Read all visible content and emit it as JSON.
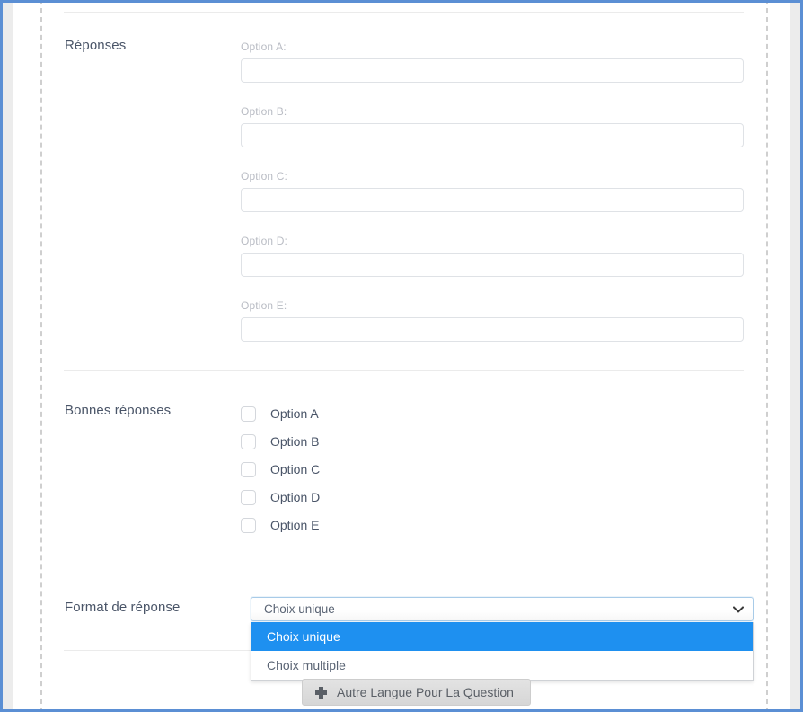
{
  "theme": {
    "accent_blue": "#5b8fd4",
    "dropdown_highlight": "#1e90f0",
    "label_color": "#4a5568",
    "caption_color": "#b9bcc4"
  },
  "form": {
    "answers": {
      "label": "Réponses",
      "options": [
        {
          "caption": "Option A:",
          "value": "",
          "placeholder": ""
        },
        {
          "caption": "Option B:",
          "value": "",
          "placeholder": ""
        },
        {
          "caption": "Option C:",
          "value": "",
          "placeholder": ""
        },
        {
          "caption": "Option D:",
          "value": "",
          "placeholder": ""
        },
        {
          "caption": "Option E:",
          "value": "",
          "placeholder": ""
        }
      ]
    },
    "correct_answers": {
      "label": "Bonnes réponses",
      "checkboxes": [
        {
          "label": "Option A",
          "checked": false
        },
        {
          "label": "Option B",
          "checked": false
        },
        {
          "label": "Option C",
          "checked": false
        },
        {
          "label": "Option D",
          "checked": false
        },
        {
          "label": "Option E",
          "checked": false
        }
      ]
    },
    "response_format": {
      "label": "Format de réponse",
      "selected": "Choix unique",
      "expanded": true,
      "options": [
        {
          "label": "Choix unique",
          "highlighted": true
        },
        {
          "label": "Choix multiple",
          "highlighted": false
        }
      ]
    }
  },
  "actions": {
    "add_language_button": "Autre Langue Pour La Question",
    "add_language_icon": "plus-icon"
  },
  "icons": {
    "chevron_down": "chevron-down-icon"
  }
}
